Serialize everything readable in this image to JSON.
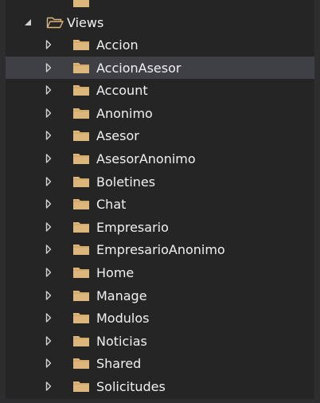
{
  "tree": {
    "root": {
      "label": "Views",
      "icon": "folder-open-icon",
      "expanded": true
    },
    "children": [
      {
        "label": "Accion",
        "selected": false
      },
      {
        "label": "AccionAsesor",
        "selected": true
      },
      {
        "label": "Account",
        "selected": false
      },
      {
        "label": "Anonimo",
        "selected": false
      },
      {
        "label": "Asesor",
        "selected": false
      },
      {
        "label": "AsesorAnonimo",
        "selected": false
      },
      {
        "label": "Boletines",
        "selected": false
      },
      {
        "label": "Chat",
        "selected": false
      },
      {
        "label": "Empresario",
        "selected": false
      },
      {
        "label": "EmpresarioAnonimo",
        "selected": false
      },
      {
        "label": "Home",
        "selected": false
      },
      {
        "label": "Manage",
        "selected": false
      },
      {
        "label": "Modulos",
        "selected": false
      },
      {
        "label": "Noticias",
        "selected": false
      },
      {
        "label": "Shared",
        "selected": false
      },
      {
        "label": "Solicitudes",
        "selected": false
      }
    ]
  },
  "colors": {
    "background": "#252526",
    "selection": "#3f3f46",
    "text": "#f1f1f1",
    "folder": "#dcb67a",
    "arrow": "#d0d0d0"
  }
}
